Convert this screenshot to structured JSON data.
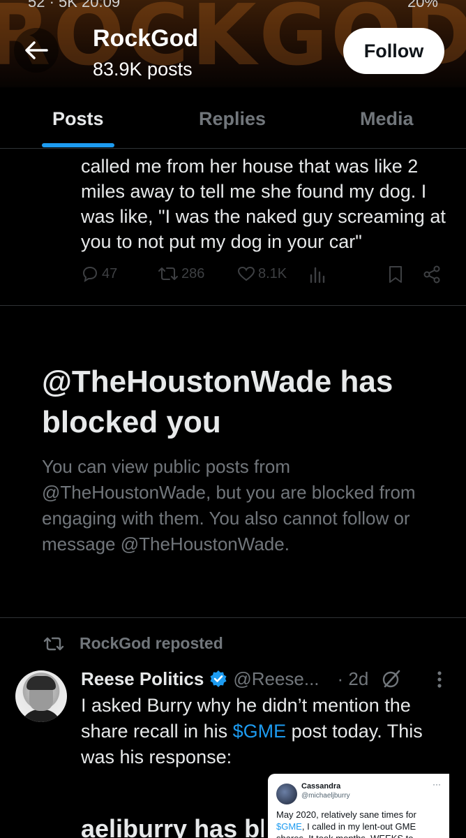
{
  "status_bar": {
    "left": "52 · 5K 20:09",
    "right": "20%"
  },
  "header": {
    "banner_text": "ROCKGOD",
    "profile_name": "RockGod",
    "post_count": "83.9K posts",
    "follow_label": "Follow"
  },
  "tabs": [
    {
      "label": "Posts",
      "active": true
    },
    {
      "label": "Replies",
      "active": false
    },
    {
      "label": "Media",
      "active": false
    }
  ],
  "tweet": {
    "text": "called me from her house that was like 2 miles away to tell me she found my dog. I was like, \"I was the naked guy screaming at you to not put my dog in your car\"",
    "replies": "47",
    "reposts": "286",
    "likes": "8.1K"
  },
  "block_notice": {
    "title": "@TheHoustonWade has blocked you",
    "body": "You can view public posts from @TheHoustonWade, but you are blocked from engaging with them. You also cannot follow or message @TheHoustonWade."
  },
  "repost": {
    "reposted_by": "RockGod reposted",
    "author_name": "Reese Politics",
    "handle": "@Reese...",
    "time": "· 2d",
    "text_before": "I asked Burry why he didn’t mention the share recall in his ",
    "cashtag": "$GME",
    "text_after": " post today. This was his response:"
  },
  "embedded_image": {
    "partial_text": "aeliburry has bl",
    "card_name": "Cassandra",
    "card_handle": "@michaeljburry",
    "card_text_before": "May 2020, relatively sane times for ",
    "card_cashtag": "$GME",
    "card_text_after": ", I called in my lent-out GME shares. It took months, WEEKS to..."
  },
  "colors": {
    "accent": "#1d9bf0",
    "muted": "#71767b",
    "text": "#e7e9ea",
    "background": "#000000"
  }
}
